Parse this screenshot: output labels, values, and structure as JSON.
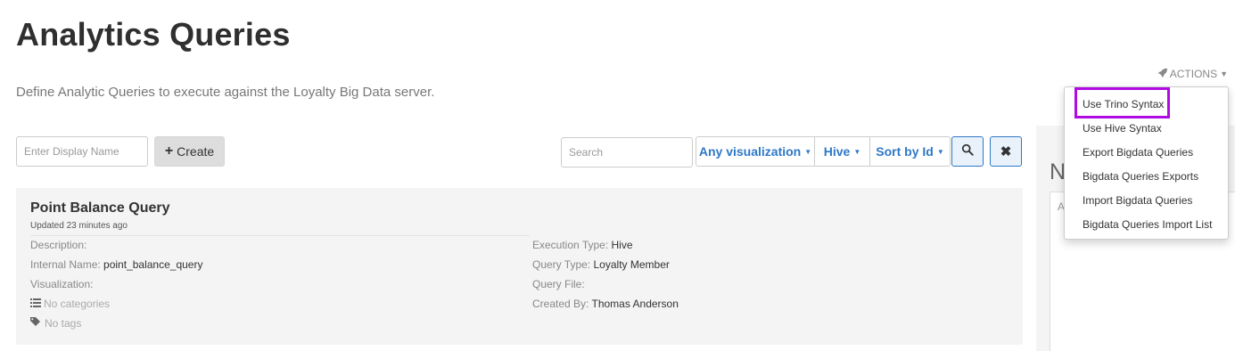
{
  "page": {
    "title": "Analytics Queries",
    "description": "Define Analytic Queries to execute against the Loyalty Big Data server."
  },
  "actions": {
    "label": "ACTIONS",
    "icon": "rocket-icon",
    "menu": [
      "Use Trino Syntax",
      "Use Hive Syntax",
      "Export Bigdata Queries",
      "Bigdata Queries Exports",
      "Import Bigdata Queries",
      "Bigdata Queries Import List"
    ],
    "highlighted_item": "Use Trino Syntax",
    "highlight_color": "#b10be4"
  },
  "toolbar": {
    "name_placeholder": "Enter Display Name",
    "create_label": "Create",
    "search_placeholder": "Search",
    "visualization_label": "Any visualization",
    "engine_label": "Hive",
    "sort_label": "Sort by Id",
    "accent_color": "#2e78c7"
  },
  "query": {
    "title": "Point Balance Query",
    "updated": "Updated 23 minutes ago",
    "description_label": "Description:",
    "internal_name_label": "Internal Name:",
    "internal_name": "point_balance_query",
    "visualization_label": "Visualization:",
    "categories": "No categories",
    "tags": "No tags",
    "execution_type_label": "Execution Type:",
    "execution_type": "Hive",
    "query_type_label": "Query Type:",
    "query_type": "Loyalty Member",
    "query_file_label": "Query File:",
    "created_by_label": "Created By:",
    "created_by": "Thomas Anderson"
  },
  "side_panel": {
    "heading": "N",
    "box_text": "A"
  }
}
